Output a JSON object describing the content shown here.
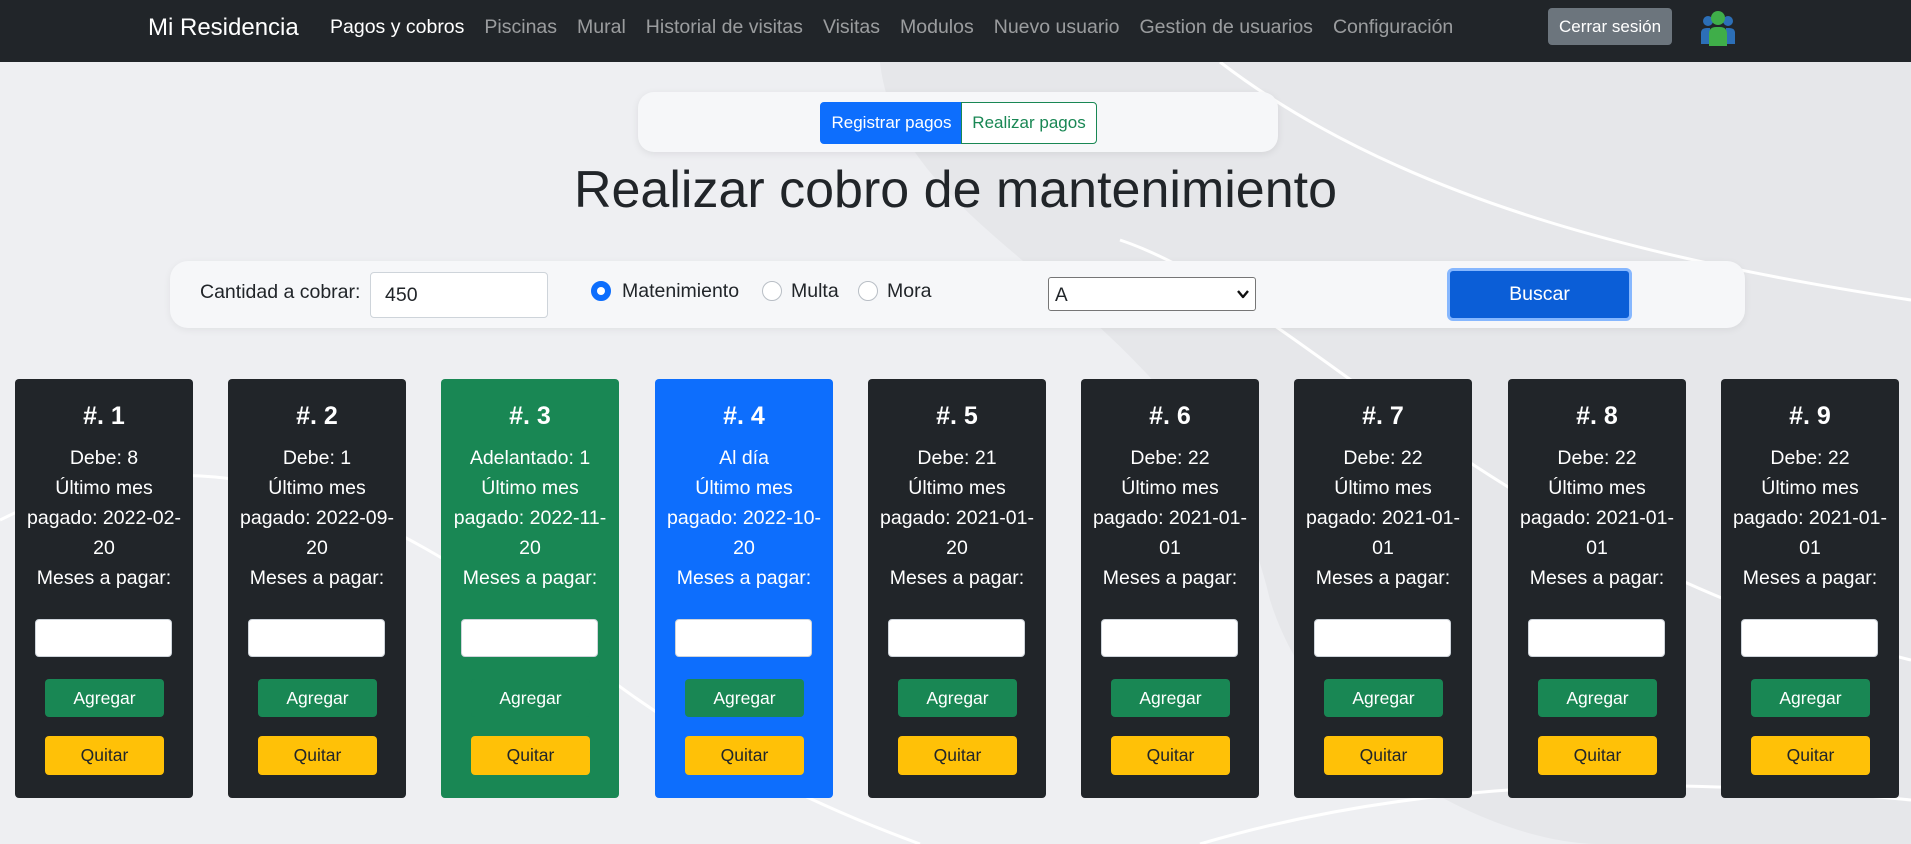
{
  "navbar": {
    "brand": "Mi Residencia",
    "links": [
      {
        "label": "Pagos y cobros",
        "active": true
      },
      {
        "label": "Piscinas"
      },
      {
        "label": "Mural"
      },
      {
        "label": "Historial de visitas"
      },
      {
        "label": "Visitas"
      },
      {
        "label": "Modulos"
      },
      {
        "label": "Nuevo usuario"
      },
      {
        "label": "Gestion de usuarios"
      },
      {
        "label": "Configuración"
      }
    ],
    "logout_label": "Cerrar sesión",
    "avatar_icon": "user-group-icon"
  },
  "tabs": {
    "register_label": "Registrar pagos",
    "make_label": "Realizar pagos",
    "active": "Registrar pagos"
  },
  "title": "Realizar cobro de mantenimiento",
  "form": {
    "amount_label": "Cantidad a cobrar:",
    "amount_value": "450",
    "radios": [
      {
        "label": "Matenimiento",
        "checked": true
      },
      {
        "label": "Multa",
        "checked": false
      },
      {
        "label": "Mora",
        "checked": false
      }
    ],
    "select_value": "A",
    "search_label": "Buscar"
  },
  "cards": [
    {
      "title": "#. 1",
      "status": "Debe: 8",
      "last_paid_label": "Último mes pagado:",
      "last_paid": "2022-02-20",
      "months_label": "Meses a pagar:",
      "variant": "dark"
    },
    {
      "title": "#. 2",
      "status": "Debe: 1",
      "last_paid_label": "Último mes pagado:",
      "last_paid": "2022-09-20",
      "months_label": "Meses a pagar:",
      "variant": "dark"
    },
    {
      "title": "#. 3",
      "status": "Adelantado: 1",
      "last_paid_label": "Último mes pagado:",
      "last_paid": "2022-11-20",
      "months_label": "Meses a pagar:",
      "variant": "green"
    },
    {
      "title": "#. 4",
      "status": "Al día",
      "last_paid_label": "Último mes pagado:",
      "last_paid": "2022-10-20",
      "months_label": "Meses a pagar:",
      "variant": "blue"
    },
    {
      "title": "#. 5",
      "status": "Debe: 21",
      "last_paid_label": "Último mes pagado:",
      "last_paid": "2021-01-20",
      "months_label": "Meses a pagar:",
      "variant": "dark"
    },
    {
      "title": "#. 6",
      "status": "Debe: 22",
      "last_paid_label": "Último mes pagado:",
      "last_paid": "2021-01-01",
      "months_label": "Meses a pagar:",
      "variant": "dark"
    },
    {
      "title": "#. 7",
      "status": "Debe: 22",
      "last_paid_label": "Último mes pagado:",
      "last_paid": "2021-01-01",
      "months_label": "Meses a pagar:",
      "variant": "dark"
    },
    {
      "title": "#. 8",
      "status": "Debe: 22",
      "last_paid_label": "Último mes pagado:",
      "last_paid": "2021-01-01",
      "months_label": "Meses a pagar:",
      "variant": "dark"
    },
    {
      "title": "#. 9",
      "status": "Debe: 22",
      "last_paid_label": "Último mes pagado:",
      "last_paid": "2021-01-01",
      "months_label": "Meses a pagar:",
      "variant": "dark"
    }
  ],
  "card_buttons": {
    "add_label": "Agregar",
    "remove_label": "Quitar"
  },
  "colors": {
    "navbar": "#212529",
    "primary": "#0d6efd",
    "success": "#198754",
    "warning": "#ffc107",
    "dark": "#212529"
  }
}
